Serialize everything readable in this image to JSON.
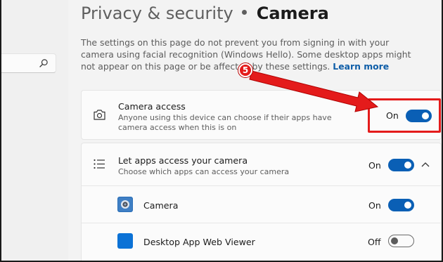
{
  "breadcrumb": {
    "parent": "Privacy & security",
    "current": "Camera"
  },
  "note": {
    "text": "The settings on this page do not prevent you from signing in with your camera using facial recognition (Windows Hello). Some desktop apps might not appear on this page or be affected by these settings.",
    "link": "Learn more"
  },
  "camera_access": {
    "title": "Camera access",
    "subtitle_line1": "Anyone using this device can choose if their apps have",
    "subtitle_line2": "camera access when this is on",
    "state": "On",
    "toggle_on": true
  },
  "apps_access": {
    "title": "Let apps access your camera",
    "subtitle": "Choose which apps can access your camera",
    "state": "On",
    "toggle_on": true,
    "expanded": true
  },
  "apps": [
    {
      "name": "Camera",
      "state": "On",
      "toggle_on": true
    },
    {
      "name": "Desktop App Web Viewer",
      "state": "Off",
      "toggle_on": false
    }
  ],
  "annotation": {
    "step_number": "5"
  },
  "colors": {
    "accent": "#0a5fb5",
    "annotation_red": "#e41b1b",
    "link": "#0f5ea8"
  },
  "icons": {
    "search": "search-icon",
    "camera": "camera-icon",
    "list": "list-icon",
    "chevron": "chevron-up-icon"
  }
}
